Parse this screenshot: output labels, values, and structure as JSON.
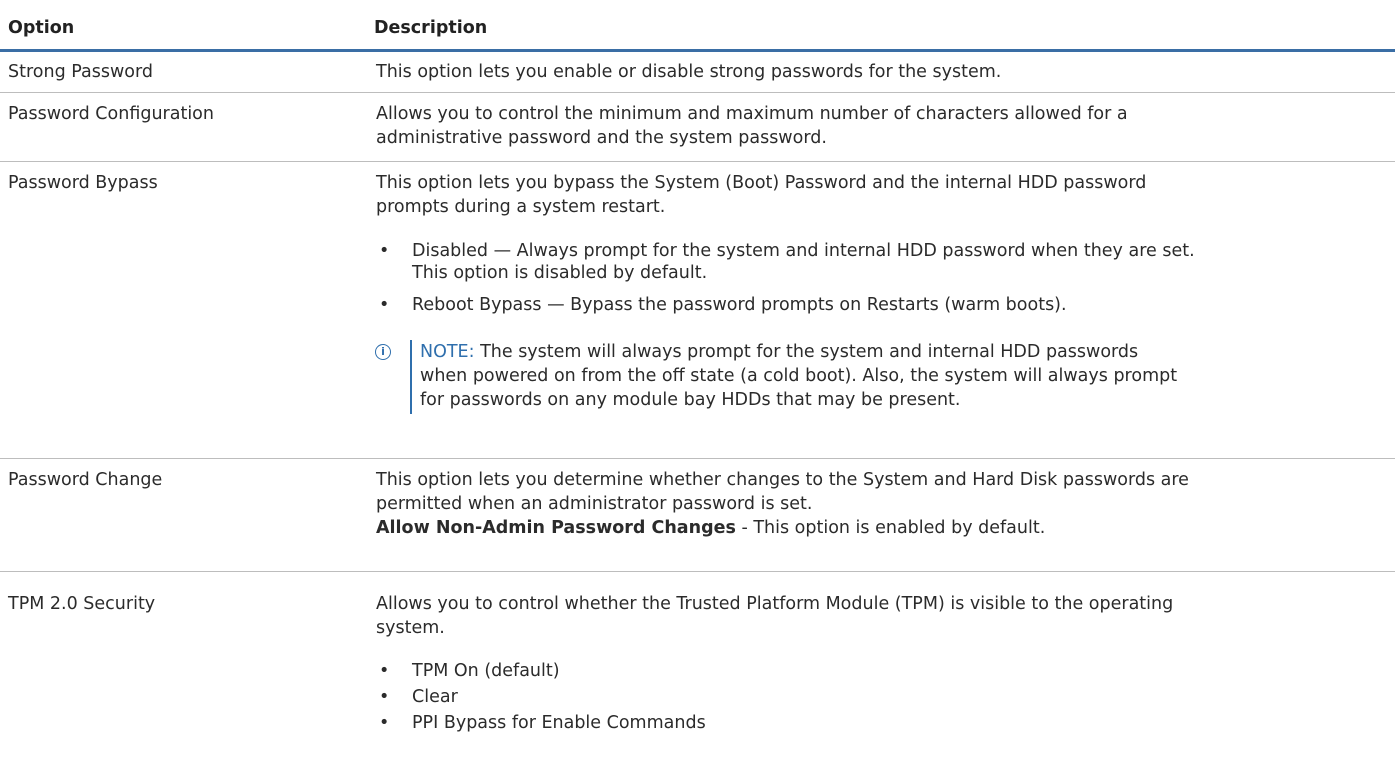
{
  "header": {
    "option": "Option",
    "description": "Description"
  },
  "rows": [
    {
      "option": "Strong Password",
      "description": "This option lets you enable or disable strong passwords for the system."
    },
    {
      "option": "Password Configuration",
      "description_line1": "Allows you to control the minimum and maximum number of characters allowed for a",
      "description_line2": "administrative password and the system password."
    },
    {
      "option": "Password Bypass",
      "description_line1": "This option lets you bypass the System (Boot) Password and the internal HDD password",
      "description_line2": "prompts during a system restart.",
      "bullets": [
        {
          "line1": "Disabled — Always prompt for the system and internal HDD password when they are set.",
          "line2": "This option is disabled by default."
        },
        {
          "line1": "Reboot Bypass — Bypass the password prompts on Restarts (warm boots)."
        }
      ],
      "note": {
        "label": "NOTE:",
        "line1": " The system will always prompt for the system and internal HDD passwords",
        "line2": "when powered on from the off state (a cold boot). Also, the system will always prompt",
        "line3": "for passwords on any module bay HDDs that may be present."
      }
    },
    {
      "option": "Password Change",
      "description_line1": "This option lets you determine whether changes to the System and Hard Disk passwords are",
      "description_line2": "permitted when an administrator password is set.",
      "bold_setting": "Allow Non-Admin Password Changes",
      "bold_setting_rest": " - This option is enabled by default."
    },
    {
      "option": "TPM 2.0 Security",
      "description_line1": "Allows you to control whether the Trusted Platform Module (TPM) is visible to the operating",
      "description_line2": "system.",
      "bullets": [
        "TPM On (default)",
        "Clear",
        "PPI Bypass for Enable Commands"
      ]
    }
  ],
  "colors": {
    "header_rule": "#3a6ea5",
    "note_accent": "#2f6fad",
    "row_divider": "#bdbdbd"
  },
  "icons": {
    "note": "info-icon",
    "bullet": "bullet-dot"
  }
}
